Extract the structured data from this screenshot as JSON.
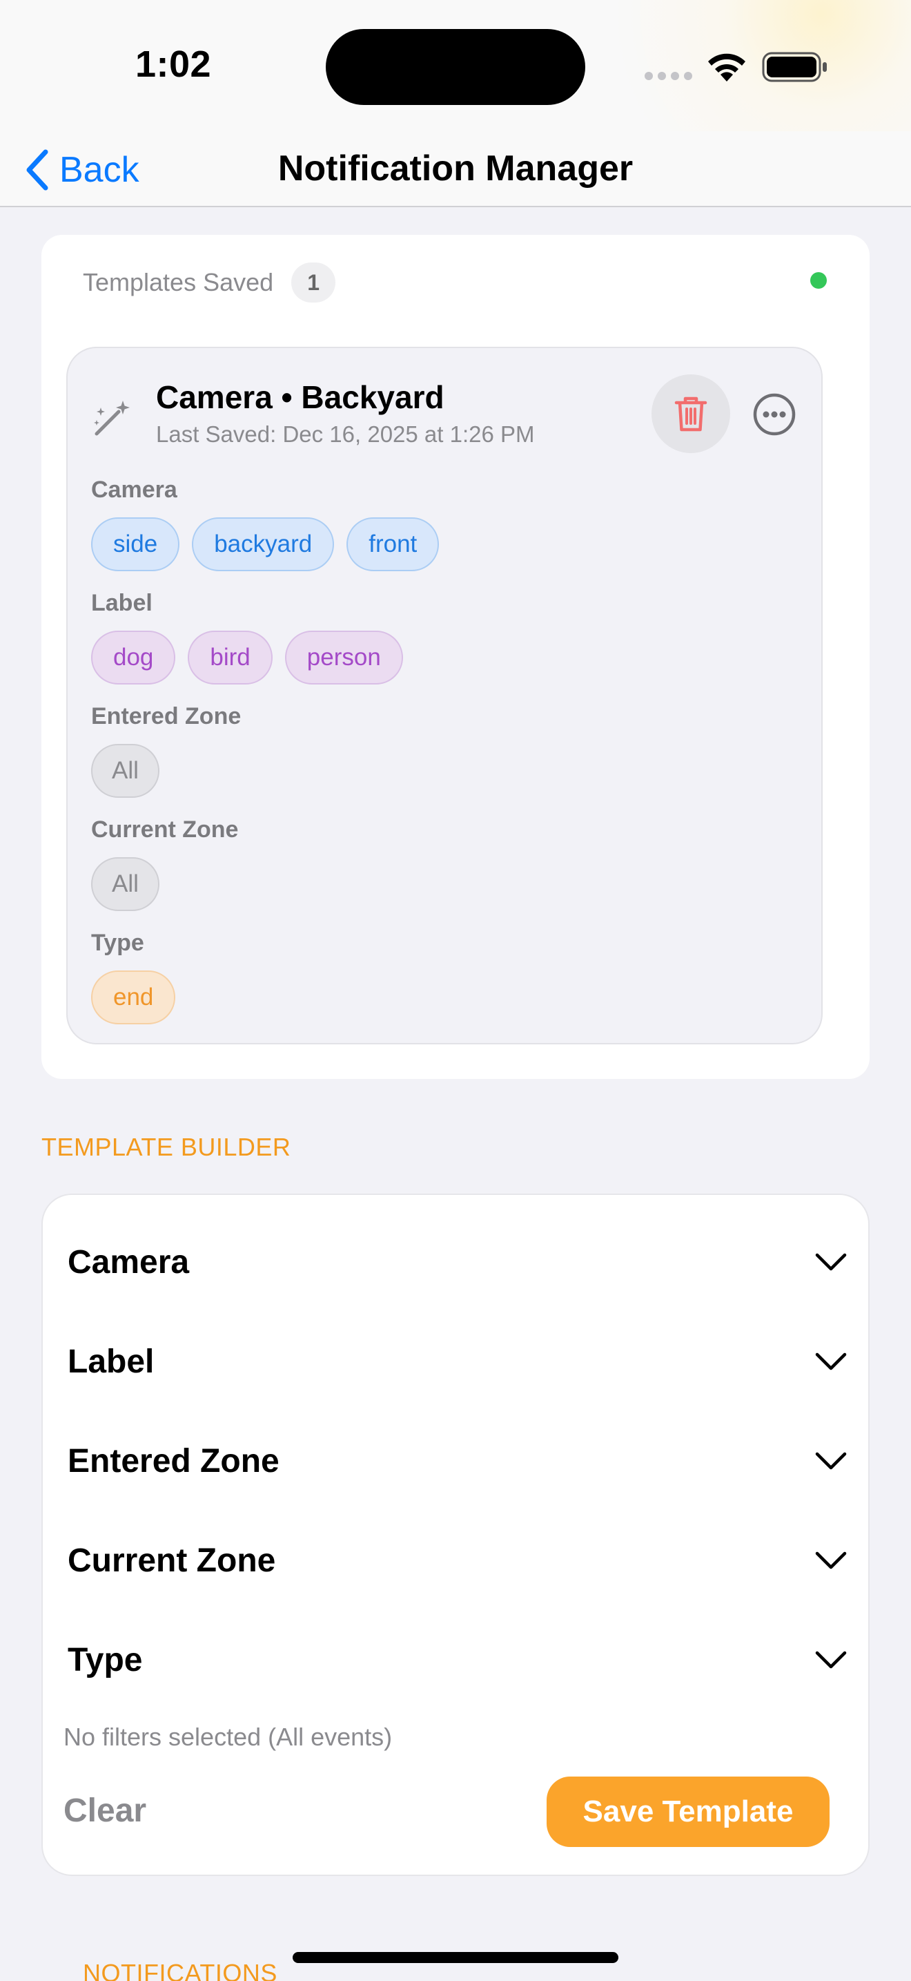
{
  "status_bar": {
    "time": "1:02"
  },
  "nav": {
    "back_label": "Back",
    "title": "Notification Manager"
  },
  "saved": {
    "title": "Templates Saved",
    "count": "1",
    "template": {
      "title": "Camera • Backyard",
      "subtitle": "Last Saved: Dec 16, 2025 at 1:26 PM",
      "groups": [
        {
          "label": "Camera",
          "chips": [
            "side",
            "backyard",
            "front"
          ]
        },
        {
          "label": "Label",
          "chips": [
            "dog",
            "bird",
            "person"
          ]
        },
        {
          "label": "Entered Zone",
          "chips": [
            "All"
          ]
        },
        {
          "label": "Current Zone",
          "chips": [
            "All"
          ]
        },
        {
          "label": "Type",
          "chips": [
            "end"
          ]
        }
      ]
    }
  },
  "builder": {
    "section_title": "TEMPLATE BUILDER",
    "rows": [
      "Camera",
      "Label",
      "Entered Zone",
      "Current Zone",
      "Type"
    ],
    "summary": "No filters selected (All events)",
    "clear_label": "Clear",
    "save_label": "Save Template"
  },
  "notifications": {
    "section_title": "NOTIFICATIONS"
  },
  "colors": {
    "accent": "#0a7aff",
    "orange": "#fba42b",
    "status_green": "#34c759",
    "delete_red": "#f26d6d"
  }
}
